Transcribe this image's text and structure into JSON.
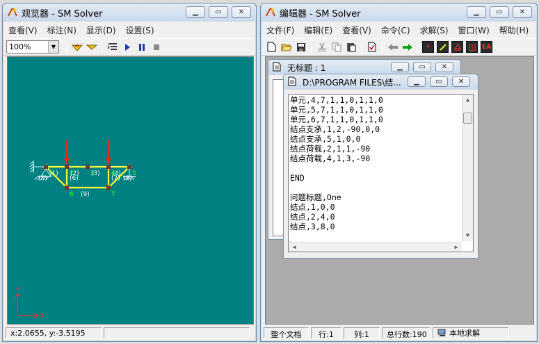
{
  "viewer": {
    "title": "观览器 - SM Solver",
    "menu": [
      "查看(V)",
      "标注(N)",
      "显示(D)",
      "设置(S)"
    ],
    "zoom": "100%",
    "status": "x:2.0655, y:-3.5195",
    "axis_y": "Y",
    "axis_x": "X",
    "structure": {
      "nodes": [
        {
          "id": "1",
          "label": "1",
          "x": 0,
          "y": 0
        },
        {
          "id": "2",
          "label": "2",
          "x": 4,
          "y": 0
        },
        {
          "id": "3",
          "label": "3",
          "x": 8,
          "y": 0
        },
        {
          "id": "4",
          "label": "4",
          "x": 12,
          "y": 0
        },
        {
          "id": "5",
          "label": "5",
          "x": 16,
          "y": 0
        },
        {
          "id": "6",
          "label": "6",
          "x": 4,
          "y": -4
        },
        {
          "id": "7",
          "label": "7",
          "x": 12,
          "y": -4
        }
      ],
      "elements": [
        {
          "label": "(1)",
          "from": "1",
          "to": "2"
        },
        {
          "label": "(2)",
          "from": "2",
          "to": "3"
        },
        {
          "label": "(3)",
          "from": "3",
          "to": "4"
        },
        {
          "label": "(4)",
          "from": "4",
          "to": "5"
        },
        {
          "label": "(5)",
          "from": "1",
          "to": "6"
        },
        {
          "label": "(6)",
          "from": "2",
          "to": "6"
        },
        {
          "label": "(7)",
          "from": "4",
          "to": "7"
        },
        {
          "label": "(8)",
          "from": "5",
          "to": "7"
        },
        {
          "label": "(9)",
          "from": "6",
          "to": "7"
        }
      ],
      "loads": [
        {
          "node": "2"
        },
        {
          "node": "4"
        }
      ],
      "supports": [
        {
          "node": "1",
          "kind": "pin"
        },
        {
          "node": "5",
          "kind": "roller"
        }
      ]
    }
  },
  "editor": {
    "title": "编辑器 - SM Solver",
    "menu": [
      "文件(F)",
      "编辑(E)",
      "查看(V)",
      "命令(C)",
      "求解(S)",
      "窗口(W)",
      "帮助(H)"
    ],
    "toolbar_text": [
      "EA"
    ],
    "doc_untitled_title": "无标题 : 1",
    "doc_path_title": "D:\\PROGRAM FILES\\结...",
    "lines": [
      "单元,4,7,1,1,0,1,1,0",
      "单元,5,7,1,1,0,1,1,0",
      "单元,6,7,1,1,0,1,1,0",
      "结点支承,1,2,-90,0,0",
      "结点支承,5,1,0,0",
      "结点荷载,2,1,1,-90",
      "结点荷载,4,1,3,-90",
      "",
      "END",
      "",
      "问题标题,One",
      "结点,1,0,0",
      "结点,2,4,0",
      "结点,3,8,0"
    ],
    "status": {
      "scope": "整个文档",
      "row": "行:1",
      "col": "列:1",
      "total": "总行数:190",
      "mode": "本地求解"
    }
  },
  "colors": {
    "canvas_bg": "#008080",
    "member": "#ffff33",
    "load": "#ff1e1e",
    "node_label": "#22ff44",
    "element_label": "#ffffff",
    "axis": "#ff2a2a"
  }
}
